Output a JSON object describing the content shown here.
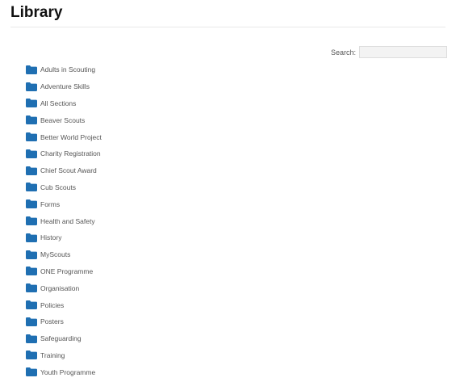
{
  "page": {
    "title": "Library"
  },
  "search": {
    "label": "Search:",
    "value": "",
    "placeholder": ""
  },
  "colors": {
    "folder_icon": "#1f6fb2",
    "text": "#555555"
  },
  "folders": [
    {
      "label": "Adults in Scouting",
      "icon": "folder-icon"
    },
    {
      "label": "Adventure Skills",
      "icon": "folder-icon"
    },
    {
      "label": "All Sections",
      "icon": "folder-icon"
    },
    {
      "label": "Beaver Scouts",
      "icon": "folder-icon"
    },
    {
      "label": "Better World Project",
      "icon": "folder-icon"
    },
    {
      "label": "Charity Registration",
      "icon": "folder-icon"
    },
    {
      "label": "Chief Scout Award",
      "icon": "folder-icon"
    },
    {
      "label": "Cub Scouts",
      "icon": "folder-icon"
    },
    {
      "label": "Forms",
      "icon": "folder-icon"
    },
    {
      "label": "Health and Safety",
      "icon": "folder-icon"
    },
    {
      "label": "History",
      "icon": "folder-icon"
    },
    {
      "label": "MyScouts",
      "icon": "folder-icon"
    },
    {
      "label": "ONE Programme",
      "icon": "folder-icon"
    },
    {
      "label": "Organisation",
      "icon": "folder-icon"
    },
    {
      "label": "Policies",
      "icon": "folder-icon"
    },
    {
      "label": "Posters",
      "icon": "folder-icon"
    },
    {
      "label": "Safeguarding",
      "icon": "folder-icon"
    },
    {
      "label": "Training",
      "icon": "folder-icon"
    },
    {
      "label": "Youth Programme",
      "icon": "folder-icon"
    }
  ]
}
